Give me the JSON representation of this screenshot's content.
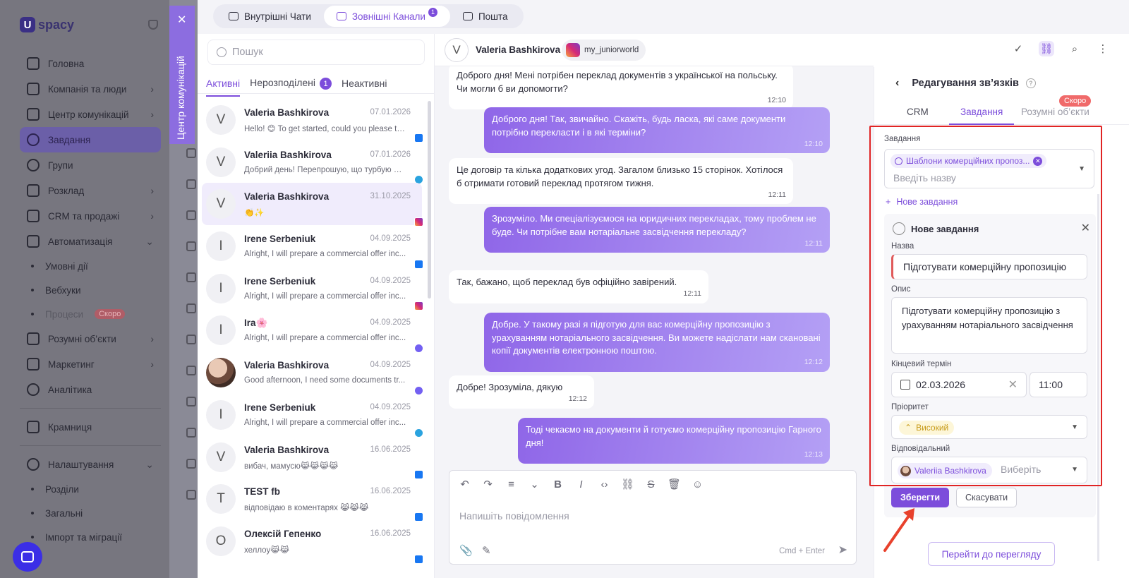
{
  "app": {
    "logo_mark": "U",
    "logo_text": "spacy",
    "nav": [
      {
        "label": "Головна"
      },
      {
        "label": "Компанія та люди",
        "chevron": "›"
      },
      {
        "label": "Центр комунікацій",
        "chevron": "›"
      },
      {
        "label": "Завдання",
        "active": true
      },
      {
        "label": "Групи"
      },
      {
        "label": "Розклад",
        "chevron": "›"
      },
      {
        "label": "CRM та продажі",
        "chevron": "›"
      },
      {
        "label": "Автоматизація",
        "chevron": "⌄"
      }
    ],
    "automation_sub": [
      "Умовні дії",
      "Вебхуки",
      "Процеси"
    ],
    "soon_label": "Скоро",
    "nav2": [
      {
        "label": "Розумні об’єкти",
        "chevron": "›"
      },
      {
        "label": "Маркетинг",
        "chevron": "›"
      },
      {
        "label": "Аналітика"
      },
      {
        "label": "Крамниця"
      },
      {
        "label": "Налаштування",
        "chevron": "⌄"
      }
    ],
    "settings_sub": [
      "Розділи",
      "Загальні",
      "Імпорт та міграції"
    ]
  },
  "comm_tab": {
    "title": "Центр комунікацій",
    "close": "✕"
  },
  "top_tabs": [
    {
      "label": "Внутрішні Чати"
    },
    {
      "label": "Зовнішні Канали",
      "active": true,
      "badge": "1"
    },
    {
      "label": "Пошта"
    }
  ],
  "chat_list": {
    "search_placeholder": "Пошук",
    "tabs": [
      {
        "label": "Активні",
        "active": true
      },
      {
        "label": "Нерозподілені",
        "badge": "1"
      },
      {
        "label": "Неактивні"
      }
    ],
    "items": [
      {
        "initial": "V",
        "name": "Valeria Bashkirova",
        "date": "07.01.2026",
        "preview": "Hello! 😊 To get started, could you please te...",
        "channel": "facebook"
      },
      {
        "initial": "V",
        "name": "Valeriia Bashkirova",
        "date": "07.01.2026",
        "preview": "Добрий день! Перепрошую, що турбую щ...",
        "channel": "telegram"
      },
      {
        "initial": "V",
        "name": "Valeria Bashkirova",
        "date": "31.10.2025",
        "preview": "👏✨",
        "channel": "instagram",
        "active": true
      },
      {
        "initial": "I",
        "name": "Irene Serbeniuk",
        "date": "04.09.2025",
        "preview": "Alright, I will prepare a commercial offer inc...",
        "channel": "facebook"
      },
      {
        "initial": "I",
        "name": "Irene Serbeniuk",
        "date": "04.09.2025",
        "preview": "Alright, I will prepare a commercial offer inc...",
        "channel": "instagram"
      },
      {
        "initial": "I",
        "name": "Ira🌸",
        "date": "04.09.2025",
        "preview": "Alright, I will prepare a commercial offer inc...",
        "channel": "viber"
      },
      {
        "initial": "",
        "name": "Valeria Bashkirova",
        "date": "04.09.2025",
        "preview": "Good afternoon, I need some documents tr...",
        "channel": "viber",
        "photo": true
      },
      {
        "initial": "I",
        "name": "Irene Serbeniuk",
        "date": "04.09.2025",
        "preview": "Alright, I will prepare a commercial offer inc...",
        "channel": "telegram"
      },
      {
        "initial": "V",
        "name": "Valeria Bashkirova",
        "date": "16.06.2025",
        "preview": "вибач, мамусю😹😹😹😹",
        "channel": "facebook"
      },
      {
        "initial": "T",
        "name": "TEST fb",
        "date": "16.06.2025",
        "preview": "відповідаю в коментарях 😹😹😹",
        "channel": "facebook"
      },
      {
        "initial": "O",
        "name": "Олексій Гепенко",
        "date": "16.06.2025",
        "preview": "хеллоу😹😹",
        "channel": "facebook"
      }
    ]
  },
  "conversation": {
    "initial": "V",
    "name": "Valeria Bashkirova",
    "channel_handle": "my_juniorworld",
    "messages": [
      {
        "dir": "in",
        "text": "Доброго дня! Мені потрібен переклад документів з української на польську. Чи могли б ви допомогти?",
        "time": "12:10"
      },
      {
        "dir": "out",
        "text": "Доброго дня! Так, звичайно. Скажіть, будь ласка, які саме документи потрібно перекласти і в які терміни?",
        "time": "12:10"
      },
      {
        "dir": "in",
        "text": "Це договір та кілька додаткових угод. Загалом близько 15 сторінок. Хотілося б отримати готовий переклад протягом тижня.",
        "time": "12:11"
      },
      {
        "dir": "out",
        "text": "Зрозуміло. Ми спеціалізуємося на юридичних перекладах, тому проблем не буде. Чи потрібне вам нотаріальне засвідчення перекладу?",
        "time": "12:11"
      },
      {
        "dir": "in",
        "text": "Так, бажано, щоб переклад був офіційно завірений.",
        "time": "12:11"
      },
      {
        "dir": "out",
        "text": "Добре. У такому разі я підготую для вас комерційну пропозицію з урахуванням нотаріального засвідчення. Ви можете надіслати нам скановані копії документів електронною поштою.",
        "time": "12:12"
      },
      {
        "dir": "in",
        "text": "Добре! Зрозуміла, дякую",
        "time": "12:12"
      },
      {
        "dir": "out",
        "text": "Тоді чекаємо на документи й готуємо комерційну пропозицію Гарного дня!",
        "time": "12:13"
      }
    ],
    "composer_placeholder": "Напишіть повідомлення",
    "send_hint": "Cmd + Enter"
  },
  "edit_links": {
    "title": "Редагування зв’язків",
    "soon": "Скоро",
    "tabs": [
      {
        "label": "CRM"
      },
      {
        "label": "Завдання",
        "active": true
      },
      {
        "label": "Розумні об’єкти"
      }
    ],
    "task_label": "Завдання",
    "task_chip": "Шаблони комерційних пропоз...",
    "task_placeholder": "Введіть назву",
    "new_task_link": "Нове завдання",
    "new_task": {
      "title": "Нове завдання",
      "name_label": "Назва",
      "name_value": "Підготувати комерційну пропозицію",
      "desc_label": "Опис",
      "desc_value": "Підготувати комерційну пропозицію з урахуванням нотаріального засвідчення",
      "due_label": "Кінцевий термін",
      "due_date": "02.03.2026",
      "due_time": "11:00",
      "priority_label": "Пріоритет",
      "priority_value": "Високий",
      "assignee_label": "Відповідальний",
      "assignee_value": "Valeriia Bashkirova",
      "assignee_placeholder": "Виберіть"
    },
    "save_button": "Зберегти",
    "cancel_button": "Скасувати",
    "view_button": "Перейти до перегляду"
  },
  "colors": {
    "accent": "#7c4ddb",
    "highlight_frame": "#e02424",
    "arrow": "#e8412c"
  }
}
